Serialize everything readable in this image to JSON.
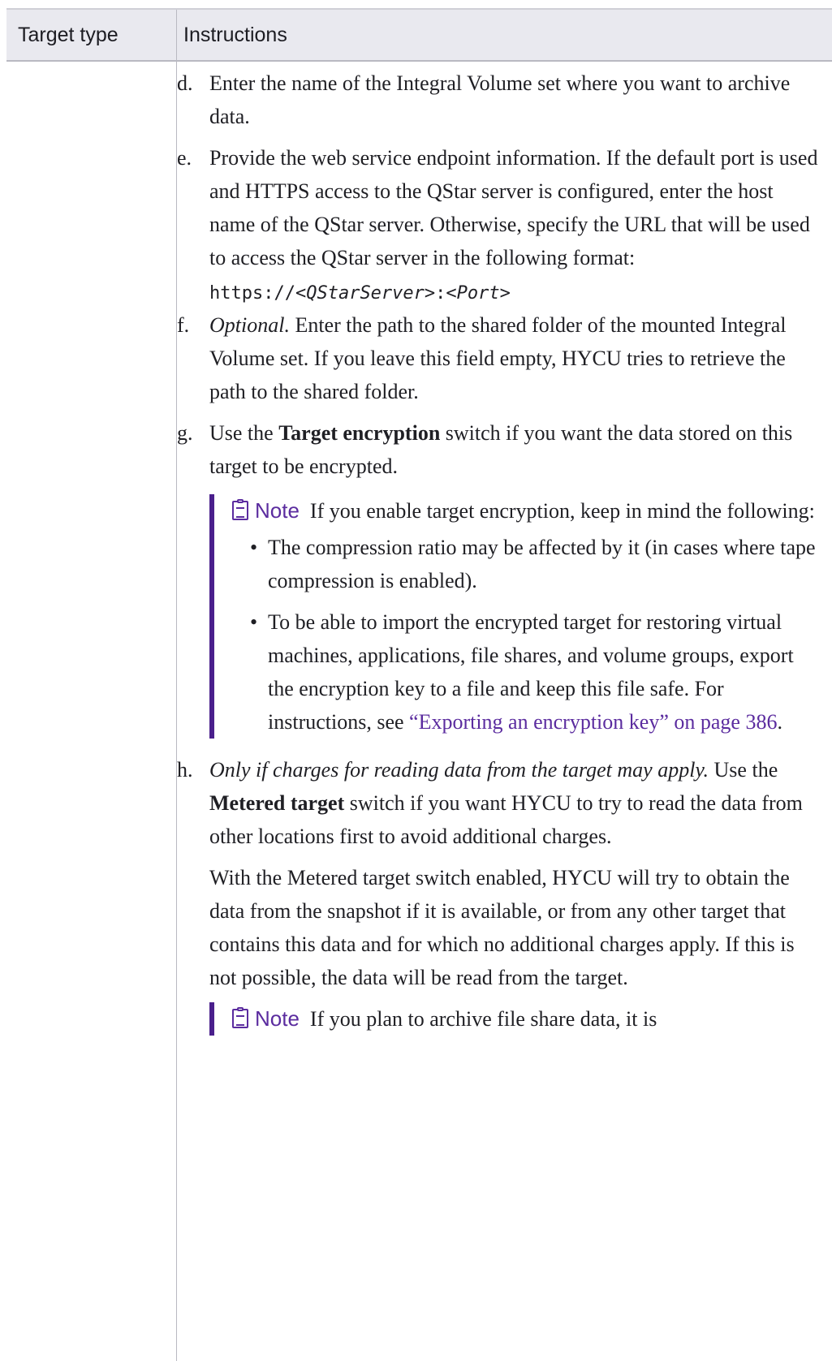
{
  "header": {
    "col1": "Target type",
    "col2": "Instructions"
  },
  "steps": {
    "d": {
      "label": "d.",
      "text": "Enter the name of the Integral Volume set where you want to archive data."
    },
    "e": {
      "label": "e.",
      "text": "Provide the web service endpoint information. If the default port is used and HTTPS access to the QStar server is configured, enter the host name of the QStar server. Otherwise, specify the URL that will be used to access the QStar server in the following format:",
      "url_prefix": "https://",
      "url_server": "<QStarServer>",
      "url_sep": ":",
      "url_port": "<Port>"
    },
    "f": {
      "label": "f.",
      "optional": "Optional.",
      "text": " Enter the path to the shared folder of the mounted Integral Volume set. If you leave this field empty, HYCU tries to retrieve the path to the shared folder."
    },
    "g": {
      "label": "g.",
      "pre": "Use the ",
      "bold": "Target encryption",
      "post": " switch if you want the data stored on this target to be encrypted."
    },
    "h": {
      "label": "h.",
      "condition": "Only if charges for reading data from the target may apply.",
      "pre": " Use the ",
      "bold": "Metered target",
      "post": " switch if you want HYCU to try to read the data from other locations first to avoid additional charges.",
      "para2": "With the Metered target switch enabled, HYCU will try to obtain the data from the snapshot if it is available, or from any other target that contains this data and for which no additional charges apply. If this is not possible, the data will be read from the target."
    }
  },
  "note1": {
    "title": "Note",
    "intro": "If you enable target encryption, keep in mind the following:",
    "bullet1": "The compression ratio may be affected by it (in cases where tape compression is enabled).",
    "bullet2_pre": "To be able to import the encrypted target for restoring virtual machines, applications, file shares, and volume groups, export the encryption key to a file and keep this file safe. For instructions, see ",
    "bullet2_link": "“Exporting an encryption key” on page 386",
    "bullet2_post": "."
  },
  "note2": {
    "title": "Note",
    "text": "If you plan to archive file share data, it is"
  }
}
